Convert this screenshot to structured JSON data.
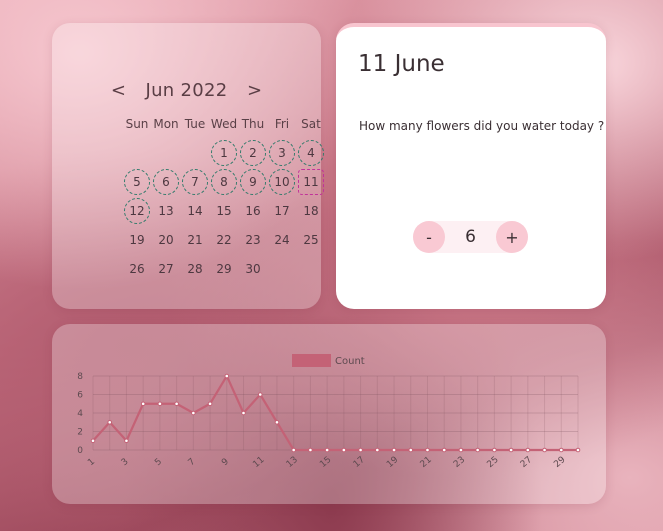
{
  "calendar": {
    "prev_label": "<",
    "next_label": ">",
    "month_label": "Jun 2022",
    "weekdays": [
      "Sun",
      "Mon",
      "Tue",
      "Wed",
      "Thu",
      "Fri",
      "Sat"
    ],
    "first_weekday": 3,
    "days_in_month": 30,
    "watered_days": [
      1,
      2,
      3,
      4,
      5,
      6,
      7,
      8,
      9,
      10,
      12
    ],
    "selected_day": 11
  },
  "detail": {
    "date_label": "11 June",
    "question": "How many flowers did you water today ?",
    "minus_label": "-",
    "plus_label": "+",
    "count_value": "6"
  },
  "colors": {
    "line": "#c46276",
    "watered_ring": "#2f7a6a",
    "selected_ring": "#c1339a"
  },
  "chart_data": {
    "type": "line",
    "x": [
      1,
      2,
      3,
      4,
      5,
      6,
      7,
      8,
      9,
      10,
      11,
      12,
      13,
      14,
      15,
      16,
      17,
      18,
      19,
      20,
      21,
      22,
      23,
      24,
      25,
      26,
      27,
      28,
      29,
      30
    ],
    "xtick_labels": [
      "1",
      "3",
      "5",
      "7",
      "9",
      "11",
      "13",
      "15",
      "17",
      "19",
      "21",
      "23",
      "25",
      "27",
      "29"
    ],
    "series": [
      {
        "name": "Count",
        "values": [
          1,
          3,
          1,
          5,
          5,
          5,
          4,
          5,
          8,
          4,
          6,
          3,
          0,
          0,
          0,
          0,
          0,
          0,
          0,
          0,
          0,
          0,
          0,
          0,
          0,
          0,
          0,
          0,
          0,
          0
        ]
      }
    ],
    "ylim": [
      0,
      8
    ],
    "yticks": [
      0,
      2,
      4,
      6,
      8
    ],
    "grid": true,
    "legend": "top-center"
  }
}
